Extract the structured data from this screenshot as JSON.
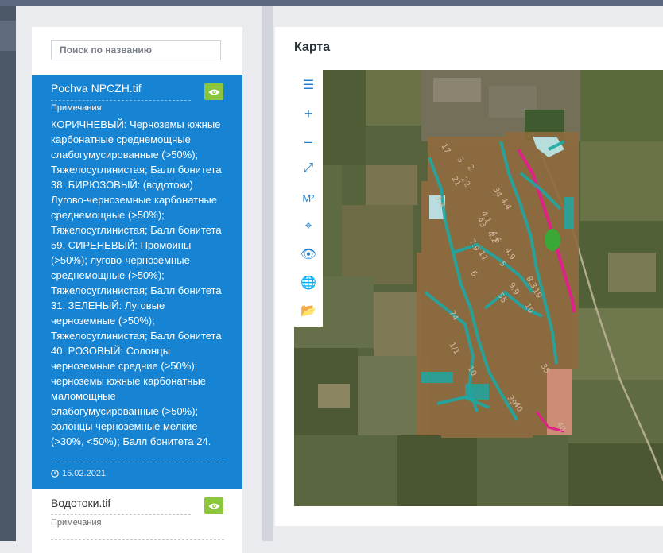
{
  "search": {
    "placeholder": "Поиск по названию"
  },
  "layers": [
    {
      "title": "Pochva NPCZH.tif",
      "notes_label": "Примечания",
      "notes": "КОРИЧНЕВЫЙ: Черноземы южные карбонатные среднемощные слабогумусированные (>50%); Тяжелосуглинистая; Балл бонитета 38. БИРЮЗОВЫЙ: (водотоки) Лугово-черноземные карбонатные среднемощные (>50%); Тяжелосуглинистая; Балл бонитета 59. СИРЕНЕВЫЙ: Промоины (>50%); лугово-черноземные среднемощные (>50%); Тяжелосуглинистая; Балл бонитета 31. ЗЕЛЕНЫЙ: Луговые черноземные (>50%); Тяжелосуглинистая; Балл бонитета 40. РОЗОВЫЙ: Солонцы черноземные средние (>50%); черноземы южные карбонатные маломощные слабогумусированные (>50%); солонцы черноземные мелкие (>30%, <50%); Балл бонитета 24.",
      "date": "15.02.2021",
      "visible_icon": "eye-icon"
    },
    {
      "title": "Водотоки.tif",
      "notes_label": "Примечания",
      "visible_icon": "eye-icon"
    }
  ],
  "map": {
    "title": "Карта",
    "tools": [
      {
        "name": "layers-list-icon",
        "glyph": "☰"
      },
      {
        "name": "zoom-in-icon",
        "glyph": "+"
      },
      {
        "name": "zoom-out-icon",
        "glyph": "–"
      },
      {
        "name": "full-extent-icon",
        "glyph": "⤢"
      },
      {
        "name": "measure-area-icon",
        "glyph": "M²"
      },
      {
        "name": "locate-icon",
        "glyph": "⌖"
      },
      {
        "name": "visibility-icon",
        "glyph": "👁"
      },
      {
        "name": "globe-icon",
        "glyph": "🌐"
      },
      {
        "name": "open-folder-icon",
        "glyph": "📂"
      }
    ],
    "plot_labels": [
      "17",
      "3",
      "2",
      "21",
      "22",
      "3.4",
      "34",
      "4.4",
      "4.1",
      "43",
      "4.2",
      "7.9",
      "4.6",
      "11",
      "6",
      "5",
      "4.9",
      "9.9",
      "8.3",
      "19",
      "10",
      "74",
      "55",
      "1/1",
      "10",
      "39",
      "40",
      "35",
      "40"
    ]
  },
  "colors": {
    "accent": "#1684d3",
    "eye_button": "#8cc63f",
    "tool_icon": "#1f7fd0"
  }
}
